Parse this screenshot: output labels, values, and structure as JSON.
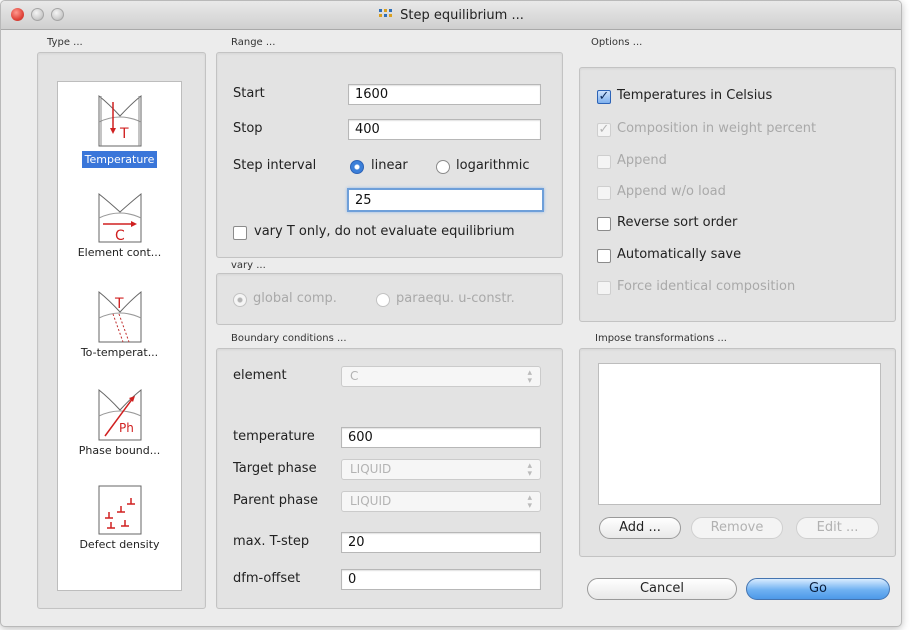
{
  "window": {
    "title": "Step equilibrium ..."
  },
  "type": {
    "label": "Type ...",
    "items": [
      {
        "label": "Temperature",
        "icon": "temperature-icon",
        "selected": true
      },
      {
        "label": "Element cont...",
        "icon": "element-content-icon",
        "selected": false
      },
      {
        "label": "To-temperat...",
        "icon": "to-temperature-icon",
        "selected": false
      },
      {
        "label": "Phase bound...",
        "icon": "phase-boundary-icon",
        "selected": false
      },
      {
        "label": "Defect density",
        "icon": "defect-density-icon",
        "selected": false
      }
    ]
  },
  "range": {
    "label": "Range ...",
    "start_label": "Start",
    "start_value": "1600",
    "stop_label": "Stop",
    "stop_value": "400",
    "step_label": "Step interval",
    "linear_label": "linear",
    "log_label": "logarithmic",
    "step_value": "25",
    "vary_only_label": "vary T only, do not evaluate equilibrium"
  },
  "vary": {
    "label": "vary ...",
    "global_label": "global comp.",
    "paraequ_label": "paraequ. u-constr."
  },
  "boundary": {
    "label": "Boundary conditions ...",
    "element_label": "element",
    "element_value": "C",
    "temperature_label": "temperature",
    "temperature_value": "600",
    "target_label": "Target phase",
    "target_value": "LIQUID",
    "parent_label": "Parent phase",
    "parent_value": "LIQUID",
    "maxt_label": "max. T-step",
    "maxt_value": "20",
    "dfm_label": "dfm-offset",
    "dfm_value": "0"
  },
  "options": {
    "label": "Options ...",
    "items": [
      {
        "label": "Temperatures in Celsius",
        "checked": true,
        "enabled": true
      },
      {
        "label": "Composition in weight percent",
        "checked": true,
        "enabled": false
      },
      {
        "label": "Append",
        "checked": false,
        "enabled": false
      },
      {
        "label": "Append w/o load",
        "checked": false,
        "enabled": false
      },
      {
        "label": "Reverse sort order",
        "checked": false,
        "enabled": true
      },
      {
        "label": "Automatically save",
        "checked": false,
        "enabled": true
      },
      {
        "label": "Force identical composition",
        "checked": false,
        "enabled": false
      }
    ]
  },
  "impose": {
    "label": "Impose transformations ...",
    "add_label": "Add ...",
    "remove_label": "Remove",
    "edit_label": "Edit ..."
  },
  "footer": {
    "cancel_label": "Cancel",
    "go_label": "Go"
  },
  "colors": {
    "selection": "#3a76d9",
    "accent": "#6fb1f2",
    "close_button": "#e0443a"
  }
}
